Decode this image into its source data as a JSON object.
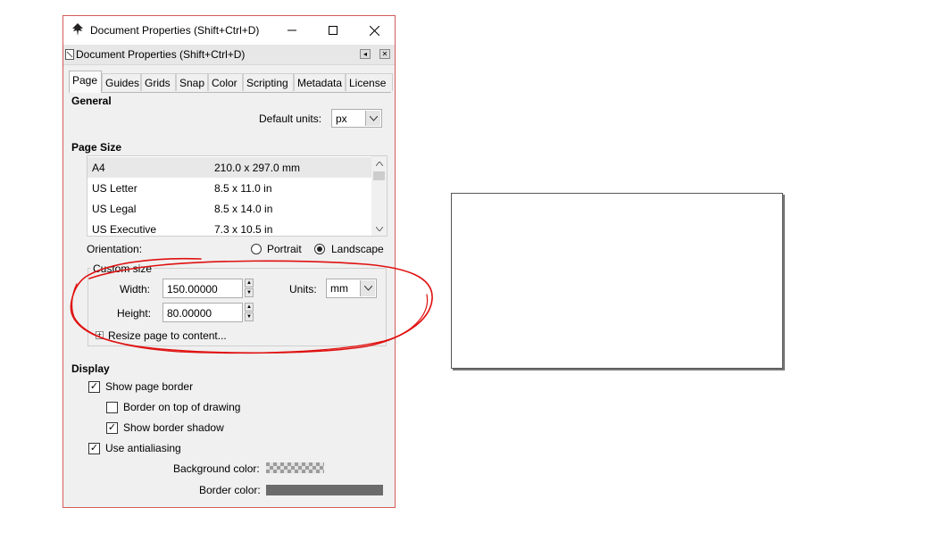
{
  "window": {
    "title": "Document Properties (Shift+Ctrl+D)",
    "subtitle": "Document Properties (Shift+Ctrl+D)",
    "buttons": {
      "minimize": "—",
      "maximize": "☐",
      "close": "✕"
    }
  },
  "tabs": [
    {
      "label": "Page",
      "active": true
    },
    {
      "label": "Guides"
    },
    {
      "label": "Grids"
    },
    {
      "label": "Snap"
    },
    {
      "label": "Color"
    },
    {
      "label": "Scripting"
    },
    {
      "label": "Metadata"
    },
    {
      "label": "License"
    }
  ],
  "general": {
    "heading": "General",
    "default_units_label": "Default units:",
    "default_units_value": "px"
  },
  "page_size": {
    "heading": "Page Size",
    "rows": [
      {
        "name": "A4",
        "size": "210.0 x 297.0 mm",
        "selected": true
      },
      {
        "name": "US Letter",
        "size": "8.5 x 11.0 in"
      },
      {
        "name": "US Legal",
        "size": "8.5 x 14.0 in"
      },
      {
        "name": "US Executive",
        "size": "7.3 x 10.5 in"
      }
    ],
    "orientation_label": "Orientation:",
    "portrait": "Portrait",
    "landscape": "Landscape",
    "orientation_selected": "landscape"
  },
  "custom_size": {
    "legend": "Custom size",
    "width_label": "Width:",
    "width_value": "150.00000",
    "height_label": "Height:",
    "height_value": "80.00000",
    "units_label": "Units:",
    "units_value": "mm",
    "resize_label": "Resize page to content..."
  },
  "display": {
    "heading": "Display",
    "show_page_border": "Show page border",
    "show_page_border_checked": true,
    "border_on_top": "Border on top of drawing",
    "border_on_top_checked": false,
    "show_border_shadow": "Show border shadow",
    "show_border_shadow_checked": true,
    "use_antialiasing": "Use antialiasing",
    "use_antialiasing_checked": true,
    "background_color_label": "Background color:",
    "border_color_label": "Border color:",
    "border_color": "#6b6b6b"
  },
  "colors": {
    "annotation": "#e01010",
    "window_border": "#d65a5a"
  }
}
